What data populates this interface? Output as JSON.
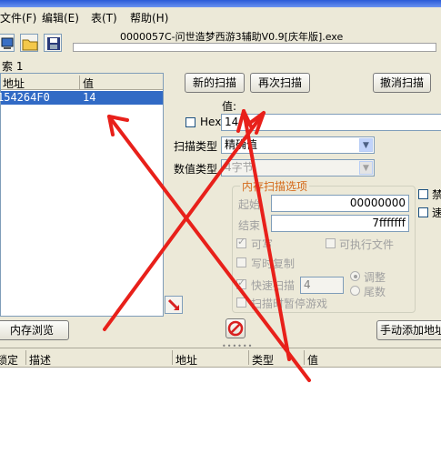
{
  "menu": {
    "file": "文件(F)",
    "edit": "编辑(E)",
    "table": "表(T)",
    "help": "帮助(H)"
  },
  "toolbar": {
    "process_title": "0000057C-问世造梦西游3辅助V0.9[庆年版].exe"
  },
  "results": {
    "found_label": "索 1",
    "col_address": "地址",
    "col_value": "值",
    "rows": [
      {
        "address": "154264F0",
        "value": "14"
      }
    ]
  },
  "scan": {
    "new_scan": "新的扫描",
    "next_scan": "再次扫描",
    "undo_scan": "撤消扫描",
    "value_label": "值:",
    "hex_label": "Hex",
    "value_input": "14",
    "scan_type_label": "扫描类型",
    "scan_type_value": "精确值",
    "value_type_label": "数值类型",
    "value_type_value": "4字节"
  },
  "mem_options": {
    "title": "内存扫描选项",
    "start_label": "起始",
    "start_value": "00000000",
    "end_label": "结束",
    "end_value": "7fffffff",
    "writable": "可写",
    "executable": "可执行文件",
    "copy_on_write": "写时复制",
    "fast_scan": "快速扫描",
    "fast_scan_value": "4",
    "align": "调整",
    "last_digits": "尾数",
    "pause_scan": "扫描时暂停游戏"
  },
  "right_side": {
    "disable": "禁",
    "speedhack": "速"
  },
  "bottom": {
    "memory_view": "内存浏览",
    "manual_add": "手动添加地址"
  },
  "cheat_table": {
    "col_freeze": "锁定",
    "col_desc": "描述",
    "col_address": "地址",
    "col_type": "类型",
    "col_value": "值"
  },
  "colors": {
    "accent_red": "#e8201a",
    "selection": "#316ac5",
    "group_title": "#d46a1a"
  }
}
